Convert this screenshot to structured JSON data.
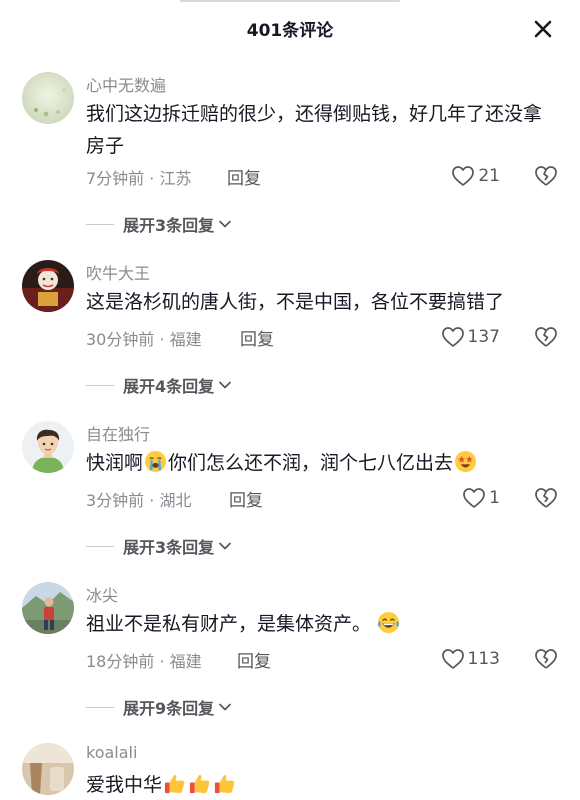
{
  "header": {
    "title": "401条评论",
    "close_label": "✕"
  },
  "comments": [
    {
      "user": "心中无数遍",
      "text": "我们这边拆迁赔的很少，还得倒贴钱，好几年了还没拿房子",
      "time_location": "7分钟前 · 江苏",
      "reply_label": "回复",
      "likes": "21",
      "expand_label": "展开3条回复"
    },
    {
      "user": "吹牛大王",
      "text": "这是洛杉矶的唐人街，不是中国，各位不要搞错了",
      "time_location": "30分钟前 · 福建",
      "reply_label": "回复",
      "likes": "137",
      "expand_label": "展开4条回复"
    },
    {
      "user": "自在独行",
      "text_a": "快润啊",
      "text_b": "你们怎么还不润，润个七八亿出去",
      "time_location": "3分钟前 · 湖北",
      "reply_label": "回复",
      "likes": "1",
      "expand_label": "展开3条回复"
    },
    {
      "user": "冰尖",
      "text": "祖业不是私有财产，是集体资产。",
      "time_location": "18分钟前 · 福建",
      "reply_label": "回复",
      "likes": "113",
      "expand_label": "展开9条回复"
    },
    {
      "user": "koalali",
      "text": "爱我中华"
    }
  ],
  "icons": {
    "close": "close-icon",
    "like": "heart-outline-icon",
    "dislike": "broken-heart-icon",
    "expand": "chevron-down-icon",
    "emojis": [
      "crying-face-emoji",
      "star-struck-face-emoji",
      "laughing-tears-emoji",
      "thumbs-up-emoji"
    ]
  },
  "colors": {
    "primary_text": "#161823",
    "secondary_text": "#8a8b91",
    "action_text": "#56575c",
    "divider": "#c9cacd"
  }
}
